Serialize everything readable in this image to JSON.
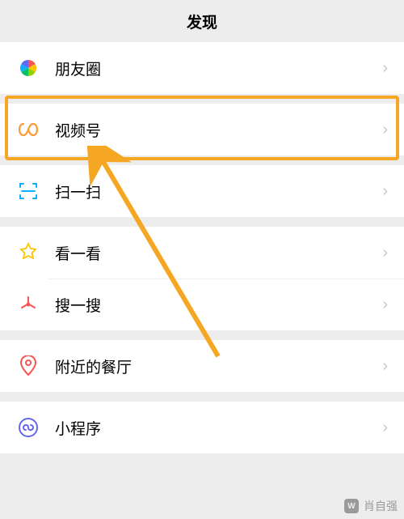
{
  "header": {
    "title": "发现"
  },
  "groups": [
    {
      "items": [
        {
          "key": "moments",
          "label": "朋友圈",
          "icon": "moments-icon"
        }
      ]
    },
    {
      "items": [
        {
          "key": "channels",
          "label": "视频号",
          "icon": "channels-icon"
        }
      ]
    },
    {
      "items": [
        {
          "key": "scan",
          "label": "扫一扫",
          "icon": "scan-icon"
        }
      ]
    },
    {
      "items": [
        {
          "key": "top-stories",
          "label": "看一看",
          "icon": "top-stories-icon"
        },
        {
          "key": "search",
          "label": "搜一搜",
          "icon": "search-icon"
        }
      ]
    },
    {
      "items": [
        {
          "key": "nearby-restaurant",
          "label": "附近的餐厅",
          "icon": "nearby-icon"
        }
      ]
    },
    {
      "items": [
        {
          "key": "mini-programs",
          "label": "小程序",
          "icon": "miniprogram-icon"
        }
      ]
    }
  ],
  "annotation": {
    "highlight_target": "channels",
    "arrow_color": "#f5a623"
  },
  "watermark": {
    "label": "肖自强",
    "brand_short": "W"
  }
}
